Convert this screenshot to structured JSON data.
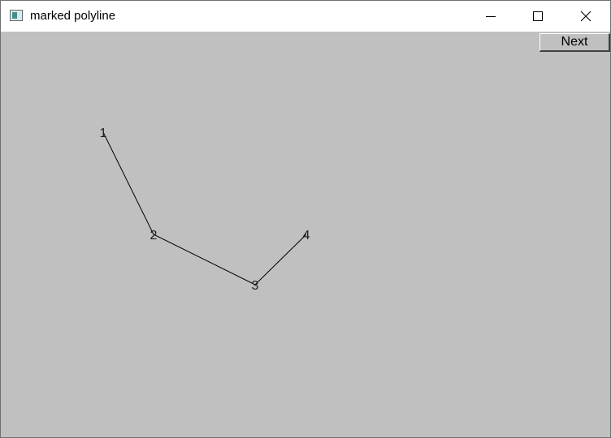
{
  "window": {
    "title": "marked polyline",
    "icon": "app-window-icon",
    "controls": {
      "minimize_icon": "minimize-icon",
      "maximize_icon": "maximize-icon",
      "close_icon": "close-icon"
    }
  },
  "toolbar": {
    "next_label": "Next"
  },
  "polyline": {
    "stroke_color": "#000000",
    "markers": [
      "1",
      "2",
      "3",
      "4"
    ]
  },
  "colors": {
    "background": "#c0c0c0",
    "titlebar": "#ffffff"
  }
}
